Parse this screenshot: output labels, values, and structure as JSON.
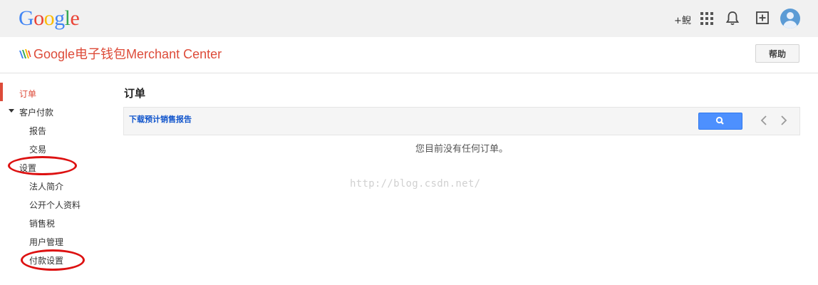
{
  "topbar": {
    "logo_letters": [
      "G",
      "o",
      "o",
      "g",
      "l",
      "e"
    ],
    "logo_colors": [
      "#4285f4",
      "#ea4335",
      "#fbbc05",
      "#4285f4",
      "#34a853",
      "#ea4335"
    ],
    "plus_user": "+鲵",
    "icons": [
      "apps-grid-icon",
      "bell-icon",
      "add-box-icon",
      "avatar-icon"
    ]
  },
  "subheader": {
    "product_title": "Google电子钱包Merchant Center",
    "help_label": "帮助",
    "accent_color": "#dd4b39"
  },
  "sidebar": {
    "items": [
      {
        "label": "订单",
        "active": true
      },
      {
        "label": "客户付款",
        "expanded": true
      },
      {
        "label": "报告"
      },
      {
        "label": "交易"
      },
      {
        "label": "设置"
      },
      {
        "label": "法人简介"
      },
      {
        "label": "公开个人资料"
      },
      {
        "label": "销售税"
      },
      {
        "label": "用户管理"
      },
      {
        "label": "付款设置"
      }
    ]
  },
  "main": {
    "title": "订单",
    "toolbar": {
      "download_link": "下载预计销售报告",
      "search_icon": "search-icon",
      "pager_prev_icon": "chevron-left-icon",
      "pager_next_icon": "chevron-right-icon"
    },
    "empty_message": "您目前没有任何订单。"
  },
  "watermark": "http://blog.csdn.net/"
}
